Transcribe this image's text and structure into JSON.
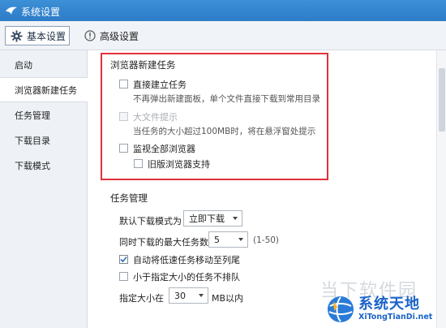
{
  "window": {
    "title": "系统设置"
  },
  "toolbar": {
    "basic_label": "基本设置",
    "advanced_label": "高级设置"
  },
  "sidebar": {
    "items": [
      {
        "label": "启动",
        "active": false
      },
      {
        "label": "浏览器新建任务",
        "active": true
      },
      {
        "label": "任务管理",
        "active": false
      },
      {
        "label": "下载目录",
        "active": false
      },
      {
        "label": "下载模式",
        "active": false
      }
    ]
  },
  "browser_section": {
    "title": "浏览器新建任务",
    "direct_task": {
      "label": "直接建立任务",
      "desc": "不再弹出新建面板，单个文件直接下载到常用目录",
      "checked": false
    },
    "large_file": {
      "label": "大文件提示",
      "desc": "当任务的大小超过100MB时，将在悬浮窗处提示",
      "checked": false,
      "disabled": true
    },
    "monitor_all": {
      "label": "监视全部浏览器",
      "checked": false
    },
    "old_browser": {
      "label": "旧版浏览器支持",
      "checked": false
    }
  },
  "task_section": {
    "title": "任务管理",
    "default_mode": {
      "label": "默认下载模式为",
      "value": "立即下载"
    },
    "max_tasks": {
      "label": "同时下载的最大任务数",
      "value": "5",
      "range": "(1-50)"
    },
    "move_slow": {
      "label": "自动将低速任务移动至列尾",
      "checked": true
    },
    "no_queue_small": {
      "label": "小于指定大小的任务不排队",
      "checked": false
    },
    "size_limit": {
      "label": "指定大小在",
      "value": "30",
      "unit": "MB以内"
    }
  },
  "watermark": {
    "text": "当下软件园",
    "brand": "系统天地",
    "url": "XiTongTianDi.net"
  },
  "colors": {
    "titlebar": "#2c7cc8",
    "highlight_box": "#e0323b",
    "checkmark": "#2f6fb5",
    "brand": "#1a63c7"
  }
}
